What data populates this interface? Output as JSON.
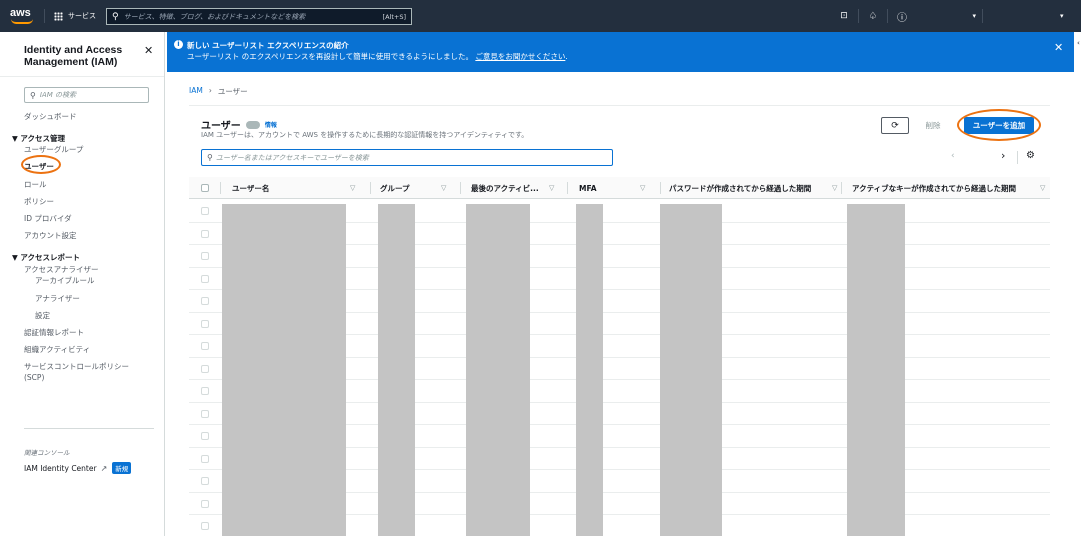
{
  "topnav": {
    "logo_text": "aws",
    "services_label": "サービス",
    "search_placeholder": "サービス、特徴、ブログ、およびドキュメントなどを検索",
    "search_shortcut": "[Alt+S]",
    "account_caret": "▾"
  },
  "sidebar": {
    "title": "Identity and Access Management (IAM)",
    "search_placeholder": "IAM の検索",
    "dashboard": "ダッシュボード",
    "access_management": {
      "label": "アクセス管理",
      "items": [
        "ユーザーグループ",
        "ユーザー",
        "ロール",
        "ポリシー",
        "ID プロバイダ",
        "アカウント設定"
      ]
    },
    "access_reports": {
      "label": "アクセスレポート",
      "items": [
        "アクセスアナライザー",
        "アーカイブルール",
        "アナライザー",
        "設定",
        "認証情報レポート",
        "組織アクティビティ",
        "サービスコントロールポリシー (SCP)"
      ]
    },
    "related_consoles_label": "関連コンソール",
    "identity_center": "IAM Identity Center",
    "new_badge": "新規"
  },
  "flash": {
    "title": "新しい ユーザーリスト エクスペリエンスの紹介",
    "message": "ユーザーリスト のエクスペリエンスを再設計して簡単に使用できるようにしました。",
    "feedback_link": "ご意見をお聞かせください"
  },
  "breadcrumb": [
    "IAM",
    "ユーザー"
  ],
  "panel": {
    "title": "ユーザー",
    "info_link": "情報",
    "description": "IAM ユーザーは、アカウントで AWS を操作するために長期的な認証情報を持つアイデンティティです。",
    "refresh_icon": "refresh-icon",
    "delete_label": "削除",
    "add_user_label": "ユーザーを追加",
    "search_placeholder": "ユーザー名またはアクセスキーでユーザーを検索"
  },
  "table": {
    "columns": [
      "ユーザー名",
      "グループ",
      "最後のアクティビ...",
      "MFA",
      "パスワードが作成されてから経過した期間",
      "アクティブなキーが作成されてから経過した期間"
    ],
    "visible_rows": 15
  },
  "colors": {
    "topnav_bg": "#232f3e",
    "primary": "#0972d3",
    "highlight": "#ec7211",
    "aws_orange": "#ff9900"
  }
}
